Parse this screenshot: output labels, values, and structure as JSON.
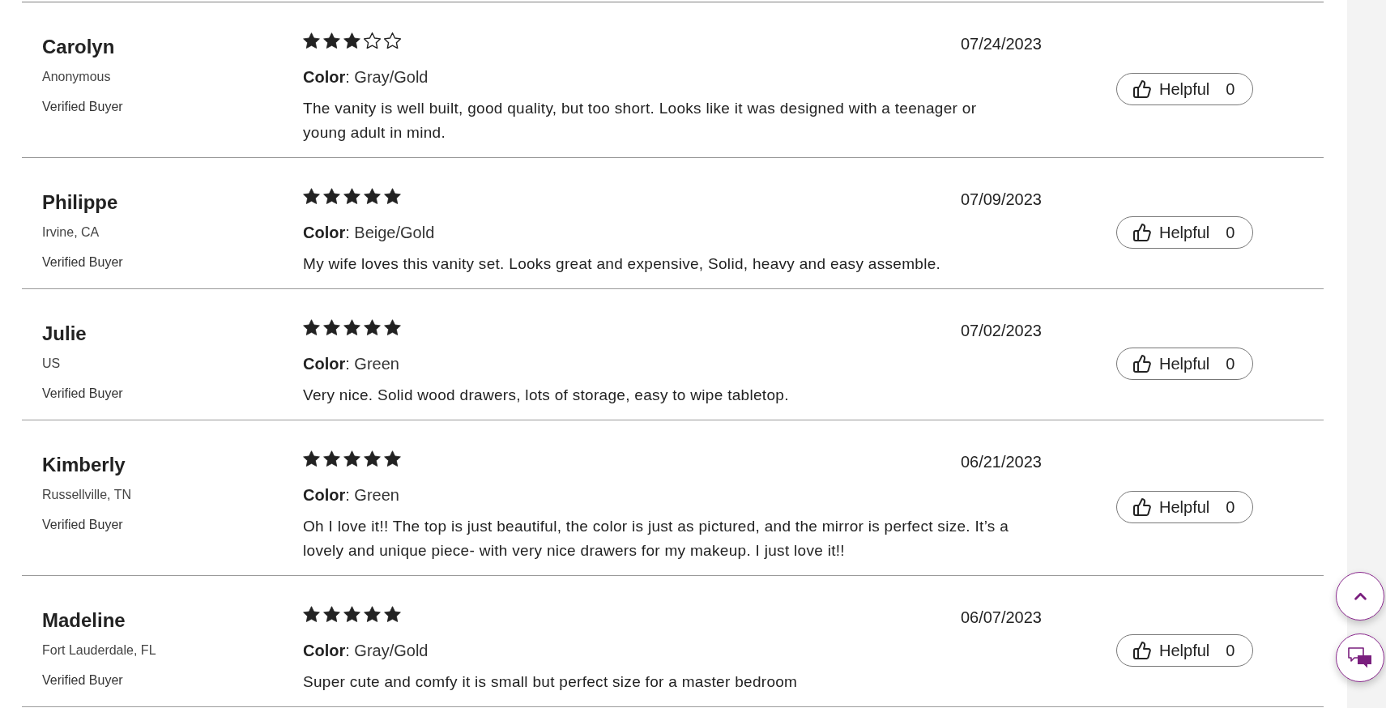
{
  "reviews": [
    {
      "name": "Carolyn",
      "location": "Anonymous",
      "badge": "Verified Buyer",
      "stars": 3,
      "date": "07/24/2023",
      "color_line": "**Color**: Gray/Gold",
      "text": "The vanity is well built, good quality, but too short. Looks like it was designed with a teenager or young adult in mind.",
      "helpful_label": "Helpful",
      "helpful_count": "0"
    },
    {
      "name": "Philippe",
      "location": "Irvine, CA",
      "badge": "Verified Buyer",
      "stars": 5,
      "date": "07/09/2023",
      "color_line": "**Color**: Beige/Gold",
      "text": "My wife loves this vanity set. Looks great and expensive, Solid, heavy and easy assemble.",
      "helpful_label": "Helpful",
      "helpful_count": "0"
    },
    {
      "name": "Julie",
      "location": "US",
      "badge": "Verified Buyer",
      "stars": 5,
      "date": "07/02/2023",
      "color_line": "**Color**: Green",
      "text": "Very nice. Solid wood drawers, lots of storage, easy to wipe tabletop.",
      "helpful_label": "Helpful",
      "helpful_count": "0"
    },
    {
      "name": "Kimberly",
      "location": "Russellville, TN",
      "badge": "Verified Buyer",
      "stars": 5,
      "date": "06/21/2023",
      "color_line": "**Color**: Green",
      "text": "Oh I love it!! The top is just beautiful, the color is just as pictured, and the mirror is perfect size. It’s a lovely and unique piece- with very nice drawers for my makeup. I just love it!!",
      "helpful_label": "Helpful",
      "helpful_count": "0"
    },
    {
      "name": "Madeline",
      "location": "Fort Lauderdale, FL",
      "badge": "Verified Buyer",
      "stars": 5,
      "date": "06/07/2023",
      "color_line": "**Color**: Gray/Gold",
      "text": "Super cute and comfy it is small but perfect size for a master bedroom",
      "helpful_label": "Helpful",
      "helpful_count": "0"
    }
  ]
}
